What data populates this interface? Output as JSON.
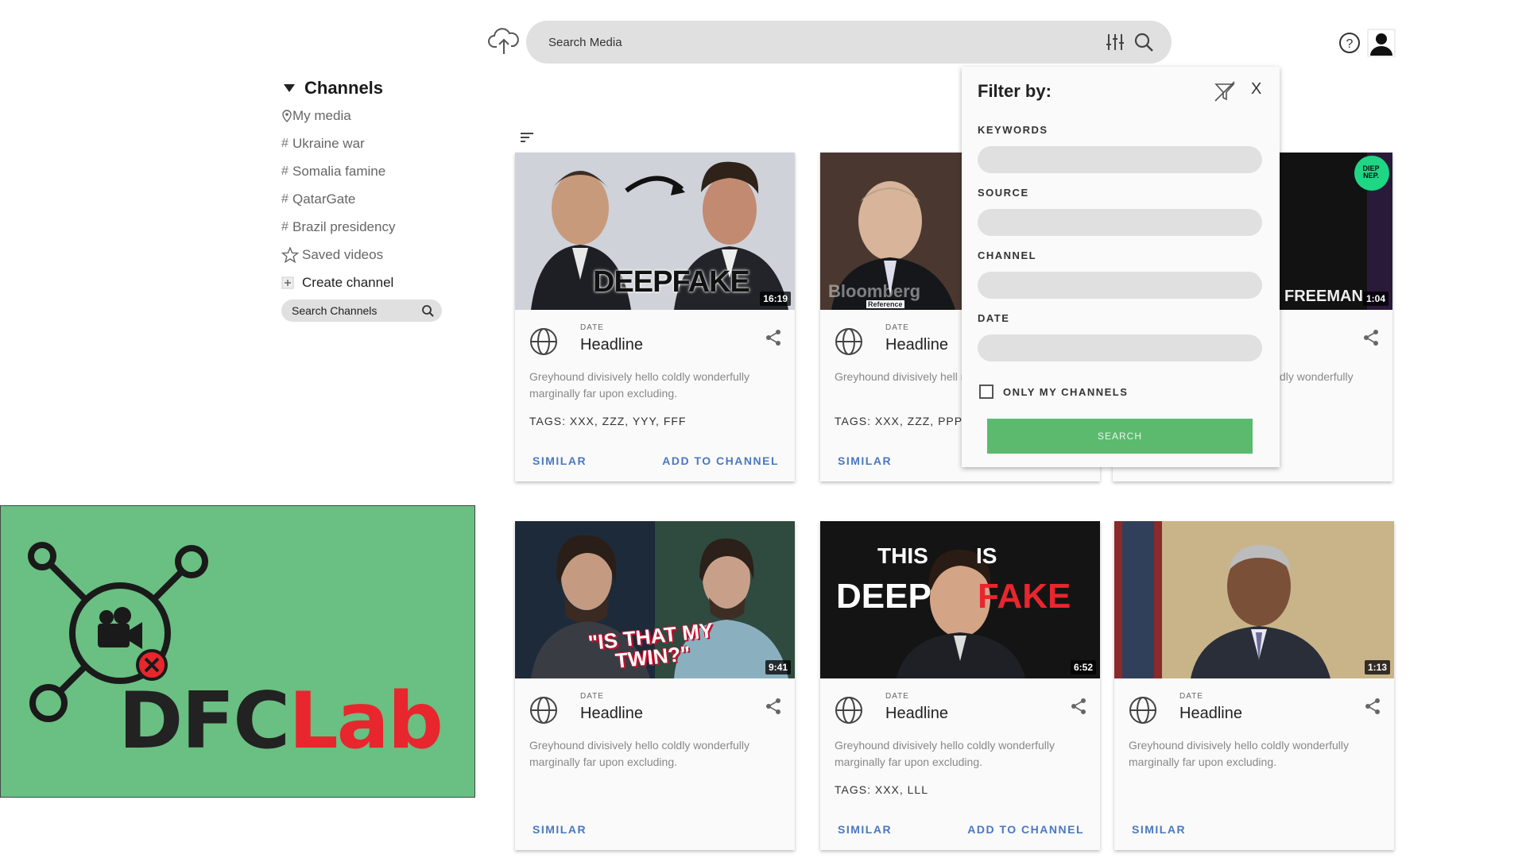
{
  "search": {
    "placeholder": "Search Media"
  },
  "sidebar": {
    "title": "Channels",
    "items": [
      {
        "prefix": "",
        "label": "My media",
        "icon": "person-pin-icon"
      },
      {
        "prefix": "#",
        "label": "Ukraine war"
      },
      {
        "prefix": "#",
        "label": "Somalia famine"
      },
      {
        "prefix": "#",
        "label": "QatarGate"
      },
      {
        "prefix": "#",
        "label": "Brazil presidency"
      },
      {
        "prefix": "",
        "label": "Saved videos",
        "icon": "star-icon"
      },
      {
        "prefix": "",
        "label": "Create channel",
        "icon": "plus-icon"
      }
    ],
    "search_placeholder": "Search Channels"
  },
  "filter": {
    "title": "Filter by:",
    "close": "X",
    "labels": {
      "keywords": "KEYWORDS",
      "source": "SOURCE",
      "channel": "CHANNEL",
      "date": "DATE"
    },
    "only_my_channels": "ONLY MY CHANNELS",
    "only_my_channels_checked": false,
    "search_button": "SEARCH"
  },
  "cards": [
    {
      "thumb_caption": "DEEPFAKE",
      "duration": "16:19",
      "date": "DATE",
      "headline": "Headline",
      "description": "Greyhound divisively hello coldly wonderfully marginally far upon excluding.",
      "tags": "TAGS: XXX, ZZZ, YYY, FFF",
      "similar": "SIMILAR",
      "add": "ADD TO CHANNEL"
    },
    {
      "thumb_caption": "Bloomberg",
      "thumb_sub": "Reference",
      "duration": "",
      "date": "DATE",
      "headline": "Headline",
      "description": "Greyhound divisively hell marginally far upon excl",
      "tags": "TAGS: XXX, ZZZ, PPP",
      "similar": "SIMILAR",
      "add": ""
    },
    {
      "thumb_caption": "N FREEMAN",
      "badge": "DIEP NEP.",
      "duration": "1:04",
      "date": "",
      "headline": "",
      "description": "dly wonderfully",
      "tags": "",
      "similar": "",
      "add": ""
    },
    {
      "thumb_caption": "\"IS THAT MY TWIN?\"",
      "duration": "9:41",
      "date": "DATE",
      "headline": "Headline",
      "description": "Greyhound divisively hello coldly wonderfully marginally far upon excluding.",
      "tags": "",
      "similar": "SIMILAR",
      "add": ""
    },
    {
      "thumb_caption_1": "THIS",
      "thumb_caption_2": "IS",
      "thumb_caption_3": "DEEP",
      "thumb_caption_4": "FAKE",
      "duration": "6:52",
      "date": "DATE",
      "headline": "Headline",
      "description": "Greyhound divisively hello coldly wonderfully marginally far upon excluding.",
      "tags": "TAGS: XXX, LLL",
      "similar": "SIMILAR",
      "add": "ADD TO CHANNEL"
    },
    {
      "duration": "1:13",
      "date": "DATE",
      "headline": "Headline",
      "description": "Greyhound divisively hello coldly wonderfully marginally far upon excluding.",
      "tags": "",
      "similar": "SIMILAR",
      "add": ""
    }
  ],
  "logo": {
    "text_dark": "DFC",
    "text_red": "Lab"
  },
  "colors": {
    "accent_green": "#5cba6f",
    "logo_bg": "#6abf82",
    "link_blue": "#4a78c2",
    "logo_red": "#e8262d"
  }
}
